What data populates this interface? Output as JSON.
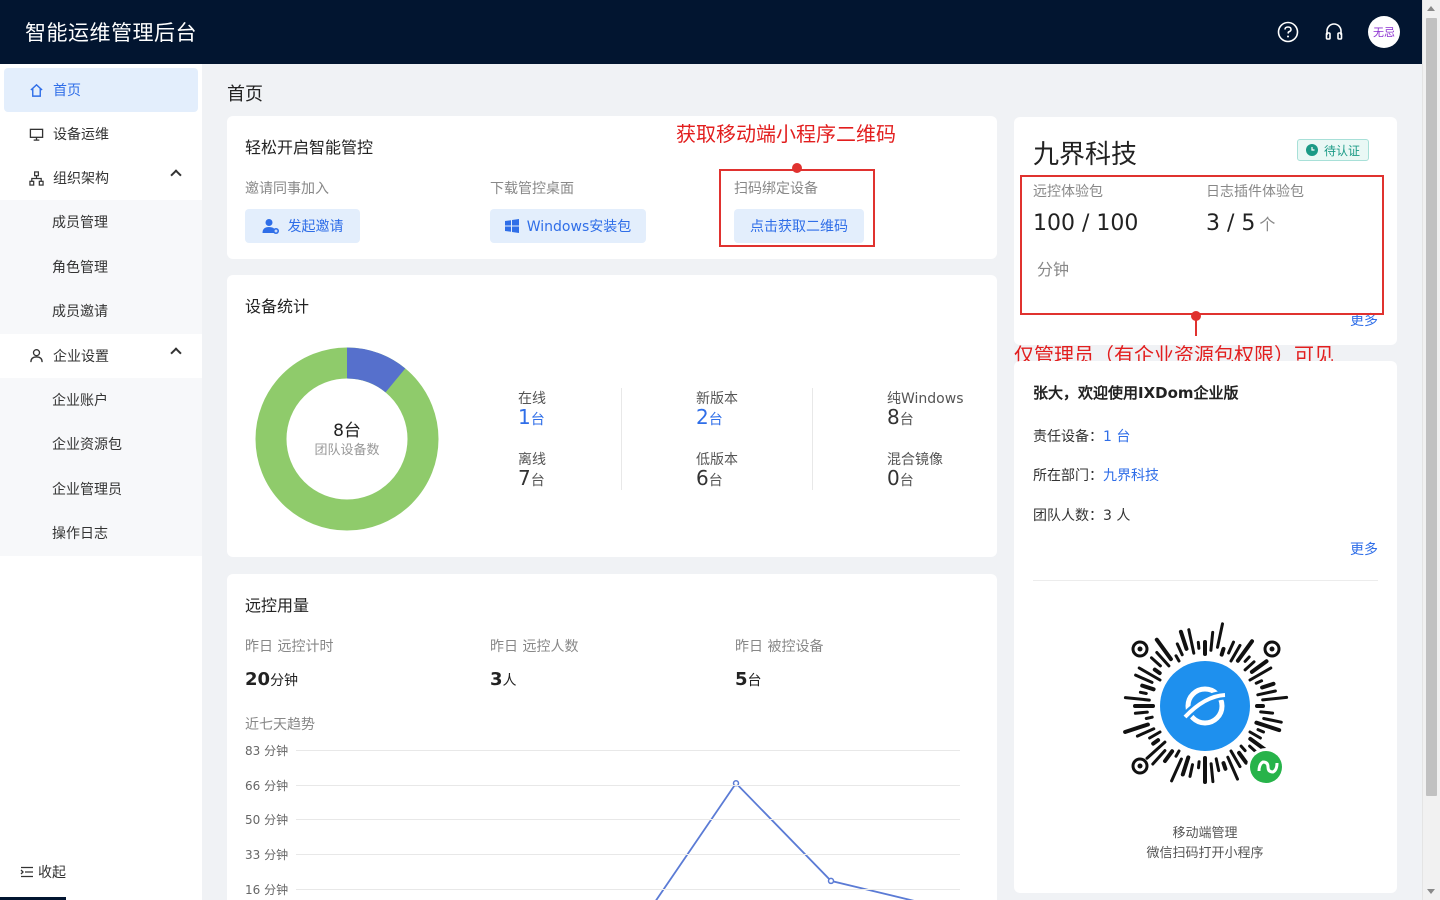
{
  "app": {
    "title": "智能运维管理后台",
    "avatar_text": "无忌"
  },
  "header_icons": [
    "help-icon",
    "headset-icon"
  ],
  "sidebar": {
    "items": [
      {
        "label": "首页",
        "icon": "home-icon",
        "active": true
      },
      {
        "label": "设备运维",
        "icon": "monitor-icon"
      },
      {
        "label": "组织架构",
        "icon": "org-chart-icon",
        "expanded": true,
        "children": [
          "成员管理",
          "角色管理",
          "成员邀请"
        ]
      },
      {
        "label": "企业设置",
        "icon": "user-icon",
        "expanded": true,
        "children": [
          "企业账户",
          "企业资源包",
          "企业管理员",
          "操作日志"
        ]
      }
    ],
    "collapse_label": "收起"
  },
  "page_title": "首页",
  "quick_start": {
    "title": "轻松开启智能管控",
    "invite": {
      "label": "邀请同事加入",
      "button": "发起邀请"
    },
    "download": {
      "label": "下载管控桌面",
      "button": "Windows安装包"
    },
    "bind": {
      "label": "扫码绑定设备",
      "button": "点击获取二维码"
    }
  },
  "annotations": {
    "qr_note": "获取移动端小程序二维码",
    "admin_note": "仅管理员（有企业资源包权限）可见"
  },
  "device_stats": {
    "title": "设备统计",
    "donut_center_value": "8台",
    "donut_center_label": "团队设备数",
    "stats": [
      {
        "label": "在线",
        "value": "1",
        "unit": "台",
        "highlight": true
      },
      {
        "label": "离线",
        "value": "7",
        "unit": "台"
      },
      {
        "label": "新版本",
        "value": "2",
        "unit": "台",
        "highlight": true
      },
      {
        "label": "低版本",
        "value": "6",
        "unit": "台"
      },
      {
        "label": "纯Windows",
        "value": "8",
        "unit": "台"
      },
      {
        "label": "混合镜像",
        "value": "0",
        "unit": "台"
      }
    ]
  },
  "remote_usage": {
    "title": "远控用量",
    "metrics": [
      {
        "label": "昨日 远控计时",
        "value": "20",
        "unit": "分钟"
      },
      {
        "label": "昨日 远控人数",
        "value": "3",
        "unit": "人"
      },
      {
        "label": "昨日 被控设备",
        "value": "5",
        "unit": "台"
      }
    ],
    "trend_title": "近七天趋势"
  },
  "chart_data": {
    "type": "line",
    "title": "近七天趋势",
    "y_tick_labels": [
      "83 分钟",
      "66 分钟",
      "50 分钟",
      "33 分钟",
      "16 分钟"
    ],
    "y_ticks": [
      83,
      66,
      50,
      33,
      16
    ],
    "ylim": [
      0,
      83
    ],
    "series": [
      {
        "values": [
          null,
          null,
          null,
          null,
          0,
          67,
          20,
          9
        ]
      }
    ],
    "grid": true,
    "color": "#5b7bd5"
  },
  "company": {
    "name": "九界科技",
    "badge": "待认证",
    "remote_pack": {
      "label": "远控体验包",
      "value": "100 / 100",
      "unit": "分钟"
    },
    "log_pack": {
      "label": "日志插件体验包",
      "value": "3 / 5",
      "unit": "个"
    },
    "more": "更多"
  },
  "welcome": {
    "title": "张大，欢迎使用IXDom企业版",
    "rows": [
      {
        "label": "责任设备：",
        "value": "1 台",
        "link": true
      },
      {
        "label": "所在部门：",
        "value": "九界科技",
        "link": true
      },
      {
        "label": "团队人数：",
        "value": "3 人",
        "link": false
      }
    ],
    "more": "更多",
    "qr_caption_1": "移动端管理",
    "qr_caption_2": "微信扫码打开小程序"
  },
  "colors": {
    "header_bg": "#021530",
    "accent": "#2f6ee8",
    "donut_green": "#8fcb6b",
    "donut_blue": "#5670cc",
    "annotation_red": "#e0322f"
  }
}
